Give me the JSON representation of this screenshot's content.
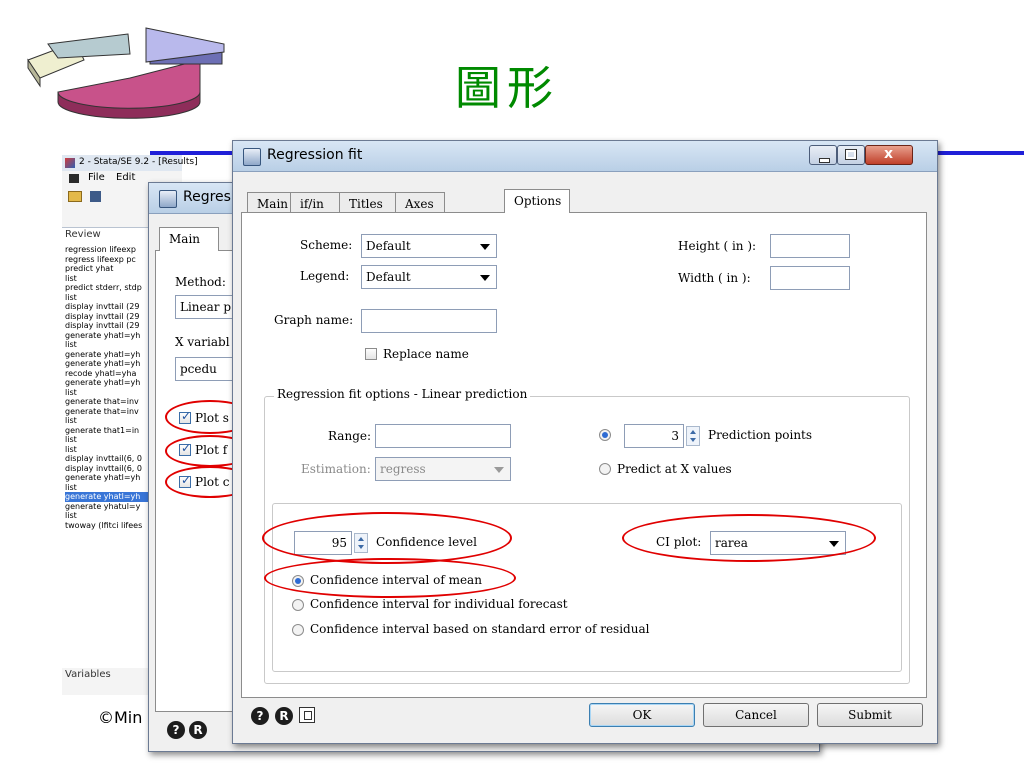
{
  "slide": {
    "title": "圖形",
    "copyright_fragment": "©Min"
  },
  "colors": {
    "title_green": "#008a00",
    "rule_blue": "#1f1fd8",
    "highlight_red": "#e00000"
  },
  "stata_window": {
    "title": "2 - Stata/SE 9.2 - [Results]",
    "menu": [
      "File",
      "Edit"
    ],
    "review_header": "Review",
    "review_items": [
      "regression lifeexp",
      "regress lifeexp pc",
      "predict yhat",
      "list",
      "predict stderr, stdp",
      "list",
      "display invttail (29",
      "display invttail (29",
      "display invttail (29",
      "generate yhatl=yh",
      "list",
      "generate yhatl=yh",
      "generate yhatl=yh",
      "recode yhatl=yha",
      "generate yhatl=yh",
      "list",
      "generate that=inv",
      "generate that=inv",
      "list",
      "generate that1=in",
      "list",
      "list",
      "display invttail(6, 0",
      "display invttail(6, 0",
      "generate yhatl=yh",
      "list",
      "generate yhatl=yh",
      "generate yhatul=y",
      "list",
      "twoway (lfitci lifees"
    ],
    "review_selected_index": 26,
    "variables_header": "Variables"
  },
  "back_dialog": {
    "title": "Regres",
    "tab_main": "Main",
    "method_label": "Method:",
    "method_value": "Linear p",
    "x_variable_label": "X variabl",
    "x_variable_value": "pcedu",
    "checkboxes": [
      "Plot s",
      "Plot f",
      "Plot c"
    ]
  },
  "dialog": {
    "title": "Regression fit",
    "tabs": [
      "Main",
      "if/in",
      "Titles",
      "Axes",
      "Options"
    ],
    "active_tab": "Options",
    "scheme_label": "Scheme:",
    "scheme_value": "Default",
    "legend_label": "Legend:",
    "legend_value": "Default",
    "graph_name_label": "Graph name:",
    "graph_name_value": "",
    "replace_name_label": "Replace name",
    "replace_name_checked": false,
    "height_label": "Height ( in ):",
    "height_value": "",
    "width_label": "Width ( in ):",
    "width_value": "",
    "group_title": "Regression fit options - Linear prediction",
    "range_label": "Range:",
    "range_value": "",
    "estimation_label": "Estimation:",
    "estimation_value": "regress",
    "prediction_points_value": "3",
    "prediction_points_label": "Prediction points",
    "prediction_points_selected": true,
    "predict_at_x_label": "Predict at X values",
    "confidence_level_value": "95",
    "confidence_level_label": "Confidence level",
    "ci_plot_label": "CI plot:",
    "ci_plot_value": "rarea",
    "ci_options": [
      "Confidence interval of mean",
      "Confidence interval for individual forecast",
      "Confidence interval based on standard error of residual"
    ],
    "ci_selected_index": 0,
    "ok_label": "OK",
    "cancel_label": "Cancel",
    "submit_label": "Submit"
  }
}
